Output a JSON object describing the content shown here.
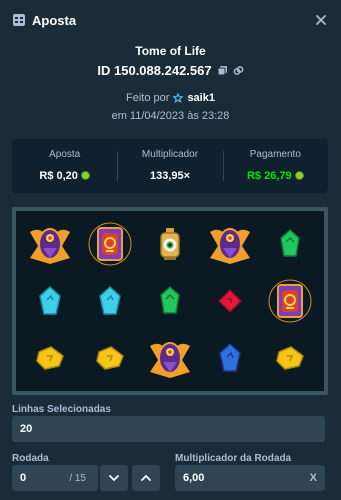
{
  "header": {
    "title": "Aposta"
  },
  "game": {
    "name": "Tome of Life",
    "bet_id": "ID 150.088.242.567"
  },
  "meta": {
    "played_by_prefix": "Feito por",
    "user": "saik1",
    "date": "em 11/04/2023 às 23:28"
  },
  "stats": {
    "bet": {
      "label": "Aposta",
      "value": "R$ 0,20"
    },
    "multiplier": {
      "label": "Multiplicador",
      "value": "133,95×"
    },
    "payout": {
      "label": "Pagamento",
      "value": "R$ 26,79"
    }
  },
  "colors": {
    "payout": "#00e701",
    "background": "#1a2c38",
    "panel": "#0f212e",
    "input": "#2f4553"
  },
  "reels": [
    [
      "scarab",
      "book",
      "eye-lantern",
      "scarab",
      "green-gem"
    ],
    [
      "blank",
      "blank",
      "blank",
      "blank",
      "book"
    ],
    [
      "cyan-gem",
      "cyan-gem",
      "green-gem",
      "red-gem",
      "blank"
    ],
    [
      "yellow-gem",
      "yellow-gem",
      "scarab",
      "blue-gem",
      "yellow-gem"
    ]
  ],
  "form": {
    "lines_label": "Linhas Selecionadas",
    "lines_value": "20",
    "round_label": "Rodada",
    "round_value": "0",
    "round_total": "/ 15",
    "round_multiplier_label": "Multiplicador da Rodada",
    "round_multiplier_value": "6,00",
    "round_multiplier_suffix": "X"
  }
}
